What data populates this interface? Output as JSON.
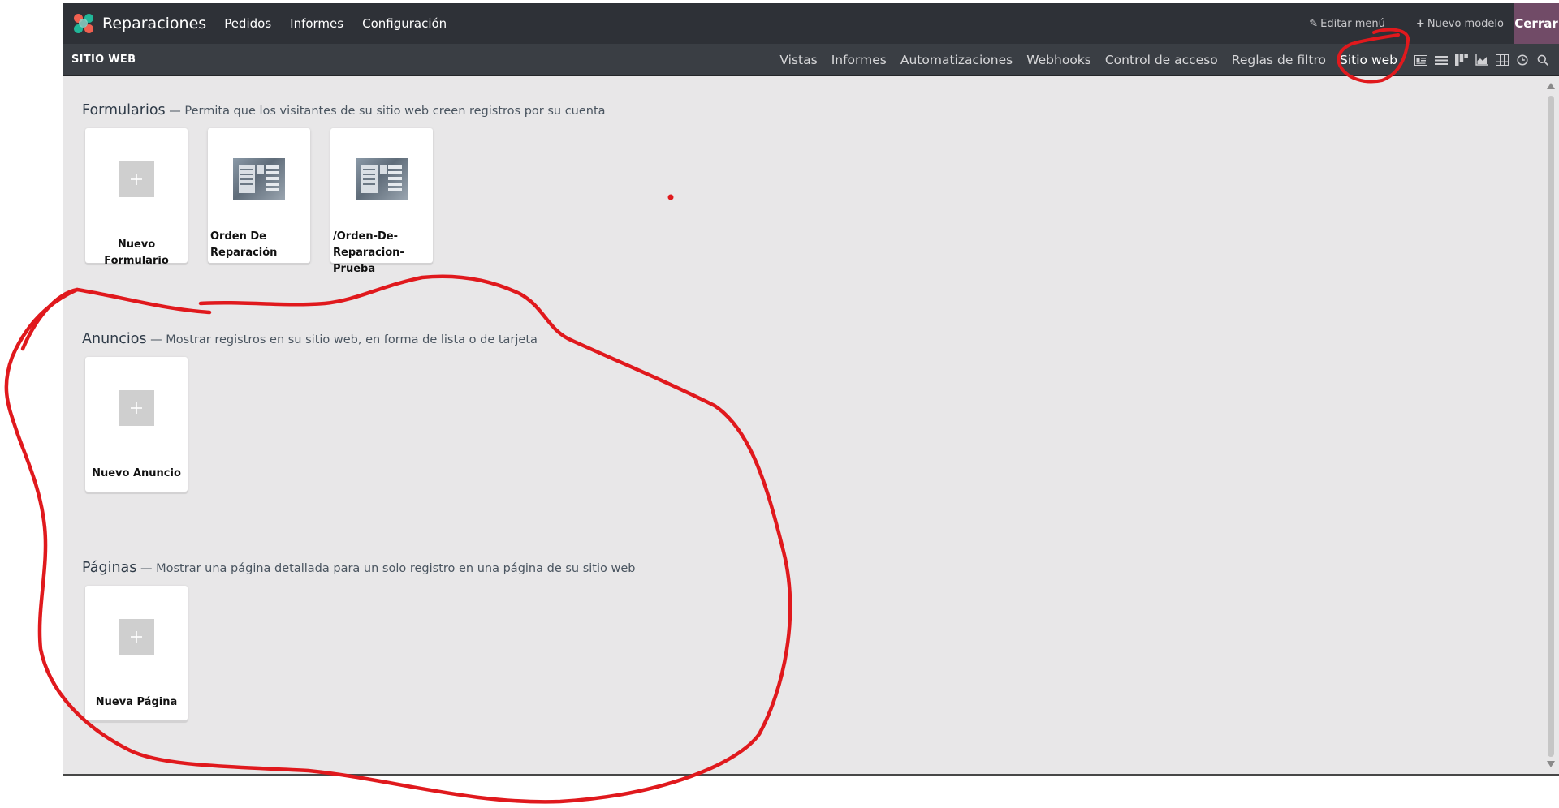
{
  "topbar": {
    "app_title": "Reparaciones",
    "menu": [
      "Pedidos",
      "Informes",
      "Configuración"
    ],
    "edit_menu": "Editar menú",
    "new_model": "Nuevo modelo",
    "close": "Cerrar"
  },
  "subbar": {
    "breadcrumb": "SITIO WEB",
    "tabs": [
      "Vistas",
      "Informes",
      "Automatizaciones",
      "Webhooks",
      "Control de acceso",
      "Reglas de filtro",
      "Sitio web"
    ],
    "view_icons": [
      "form-view-icon",
      "list-view-icon",
      "kanban-view-icon",
      "graph-view-icon",
      "pivot-view-icon",
      "activity-view-icon",
      "search-view-icon"
    ]
  },
  "sections": {
    "forms": {
      "title": "Formularios",
      "desc": " — Permita que los visitantes de su sitio web creen registros por su cuenta",
      "cards": [
        {
          "label": "Nuevo Formulario",
          "thumb": "plus-icon"
        },
        {
          "label": "Orden De Reparación",
          "thumb": "form-thumbnail"
        },
        {
          "label": "/Orden-De-Reparacion-Prueba",
          "thumb": "form-thumbnail"
        }
      ]
    },
    "listings": {
      "title": "Anuncios",
      "desc": " — Mostrar registros en su sitio web, en forma de lista o de tarjeta",
      "cards": [
        {
          "label": "Nuevo Anuncio",
          "thumb": "plus-icon"
        }
      ]
    },
    "pages": {
      "title": "Páginas",
      "desc": " — Mostrar una página detallada para un solo registro en una página de su sitio web",
      "cards": [
        {
          "label": "Nueva Página",
          "thumb": "plus-icon"
        }
      ]
    }
  },
  "colors": {
    "navbar": "#2e3137",
    "subbar": "#3a3e44",
    "close_button": "#714b67",
    "background": "#e8e7e8",
    "annotation": "#e0191d"
  }
}
